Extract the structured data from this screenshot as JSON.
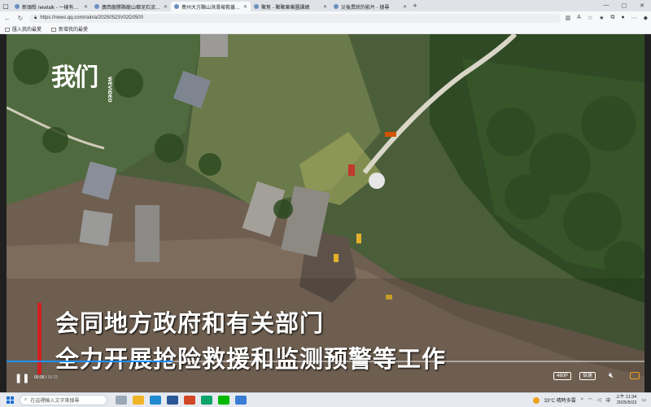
{
  "browser": {
    "tabs": [
      {
        "title": "新頭殼 newtalk - 一樣有思考力的…",
        "active": false
      },
      {
        "title": "廣西龍勝縣龍山鄉泥石流災害…",
        "active": false
      },
      {
        "title": "貴州大方縣山洪滑坡救援搶險仍在…",
        "active": true
      },
      {
        "title": "聚焦 - 聚聚樂樂圖課網",
        "active": false
      },
      {
        "title": "災後異狀的影片 - 搜尋",
        "active": false
      }
    ],
    "url": "https://news.qq.com/rain/a/20250523V02D0500",
    "favorites": [
      "匯入我的最愛",
      "新增我的最愛"
    ]
  },
  "video": {
    "logo_text": "我们",
    "logo_sub": "WEVIDEO",
    "subtitle_line1": "会同地方政府和有关部门",
    "subtitle_line2": "全力开展抢险救援和监测预警等工作",
    "current_time": "00:06",
    "duration": "00:23",
    "progress": 0.26,
    "quality_label": "480P",
    "speed_label": "倍速"
  },
  "taskbar": {
    "search_placeholder": "在這裡輸入文字來搜尋",
    "weather": "33°C 晴時多雲",
    "ime": "中",
    "time": "上午 11:34",
    "date": "2025/5/23"
  },
  "colors": {
    "accent": "#1e90ff",
    "subtitle_bar": "#d02020",
    "fullscreen_icon": "#f0a020"
  }
}
